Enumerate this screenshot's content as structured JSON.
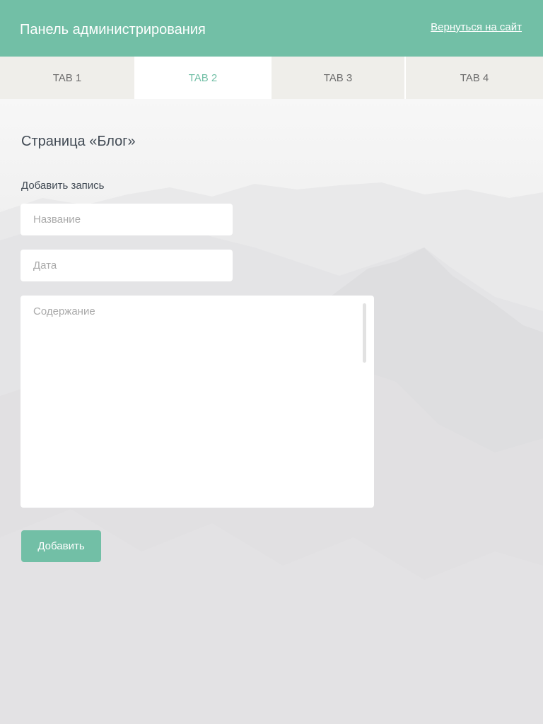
{
  "header": {
    "title": "Панель администрирования",
    "back_link": "Вернуться на сайт"
  },
  "tabs": [
    {
      "label": "TAB 1",
      "active": false
    },
    {
      "label": "TAB 2",
      "active": true
    },
    {
      "label": "TAB 3",
      "active": false
    },
    {
      "label": "TAB 4",
      "active": false
    }
  ],
  "main": {
    "page_heading": "Страница «Блог»",
    "form": {
      "section_label": "Добавить запись",
      "title_field": {
        "placeholder": "Название",
        "value": ""
      },
      "date_field": {
        "placeholder": "Дата",
        "value": ""
      },
      "content_field": {
        "placeholder": "Содержание",
        "value": ""
      },
      "submit_label": "Добавить"
    }
  },
  "colors": {
    "accent": "#72bfa6",
    "tab_bg": "#efeeea",
    "text_dark": "#414a54"
  }
}
